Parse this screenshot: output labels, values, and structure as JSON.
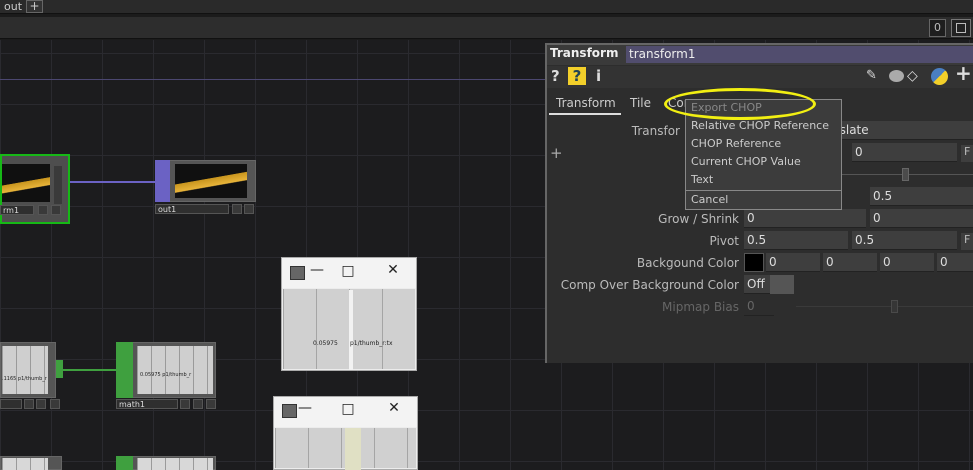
{
  "top_tabs": {
    "current_tab": "out",
    "add_tab": "+"
  },
  "network": {
    "badge_count": "0",
    "nodes": {
      "left_top": {
        "label": "rm1"
      },
      "out1": {
        "label": "out1"
      },
      "left_mid": {
        "label": ".1165  p1/thumb_r"
      },
      "math1": {
        "label": "math1",
        "thumb_text": "0.05975  p1/thumb_r"
      },
      "viewer1": {
        "value": "0.05975",
        "channel": "p1/thumb_r:tx"
      }
    }
  },
  "panel": {
    "op_type": "Transform",
    "op_name": "transform1",
    "toolbar": {
      "help": "?",
      "help_py": "?",
      "info": "i"
    },
    "tabs": [
      "Transform",
      "Tile",
      "Com"
    ],
    "add_symbol": "+",
    "params": [
      {
        "label": "Transfor",
        "values": [
          "nslate"
        ]
      },
      {
        "label": "",
        "values": [
          "0"
        ]
      },
      {
        "label": "",
        "values": [
          "0.5"
        ]
      },
      {
        "label": "Grow / Shrink",
        "values": [
          "0",
          "0"
        ]
      },
      {
        "label": "Pivot",
        "values": [
          "0.5",
          "0.5"
        ]
      },
      {
        "label": "Backgound Color",
        "values": [
          "0",
          "0",
          "0",
          "0"
        ]
      },
      {
        "label": "Comp Over Background Color",
        "values": [
          "Off"
        ]
      },
      {
        "label": "Mipmap Bias",
        "values": [
          "0"
        ]
      }
    ],
    "f_marker": "F",
    "colors": {
      "name_field": "#514d6e",
      "background_swatch": "#000000"
    }
  },
  "menu": {
    "items": [
      "Export CHOP",
      "Relative CHOP Reference",
      "CHOP Reference",
      "Current CHOP Value",
      "Text"
    ],
    "cancel": "Cancel",
    "highlight_color": "#f2ef12"
  }
}
